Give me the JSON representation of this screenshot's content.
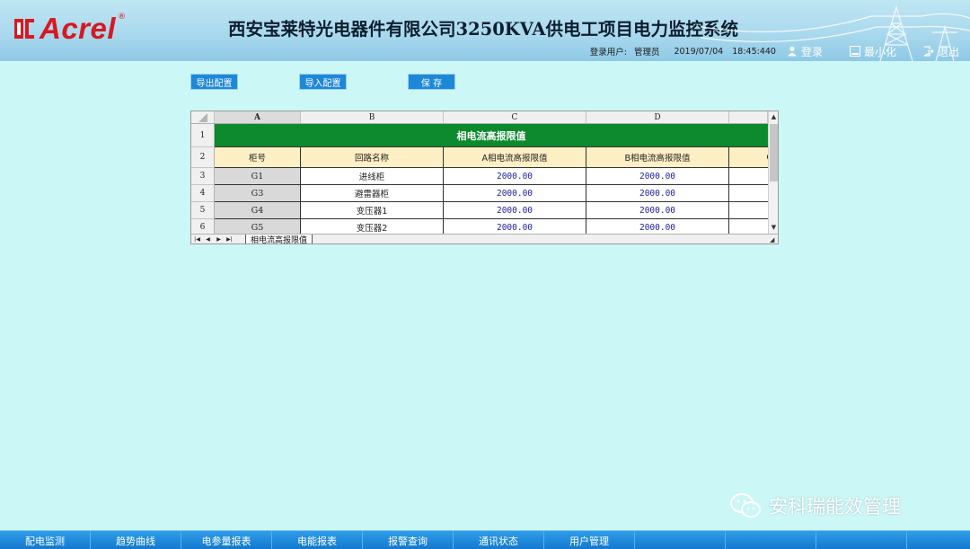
{
  "header": {
    "logo_text": "Acrel",
    "logo_reg": "®",
    "title": "西安宝莱特光电器件有限公司3250KVA供电工项目电力监控系统",
    "login_user_label": "登录用户:",
    "login_user_value": "管理员",
    "date": "2019/07/04",
    "time": "18:45:440",
    "login_button": "登录",
    "minimize_button": "最小化",
    "exit_button": "退出"
  },
  "toolbar": {
    "export_label": "导出配置",
    "import_label": "导入配置",
    "save_label": "保 存"
  },
  "sheet": {
    "columns": [
      "A",
      "B",
      "C",
      "D"
    ],
    "rows": [
      "1",
      "2",
      "3",
      "4",
      "5",
      "6"
    ],
    "merged_title": "相电流高报限值",
    "headers": [
      "柜号",
      "回路名称",
      "A相电流高报限值",
      "B相电流高报限值",
      "C"
    ],
    "data": [
      [
        "G1",
        "进线柜",
        "2000.00",
        "2000.00"
      ],
      [
        "G3",
        "避雷器柜",
        "2000.00",
        "2000.00"
      ],
      [
        "G4",
        "变压器1",
        "2000.00",
        "2000.00"
      ],
      [
        "G5",
        "变压器2",
        "2000.00",
        "2000.00"
      ]
    ],
    "tab_label": "相电流高报限值"
  },
  "watermark": "安科瑞能效管理",
  "bottom_nav": [
    "配电监测",
    "趋势曲线",
    "电参量报表",
    "电能报表",
    "报警查询",
    "通讯状态",
    "用户管理",
    "",
    "",
    "",
    ""
  ],
  "colors": {
    "background": "#ccf7f7",
    "header": "#aad9ee",
    "accent_blue": "#1e88d8",
    "title_green": "#0e8a2e",
    "header_yellow": "#ffefc4",
    "logo_red": "#d71920"
  }
}
